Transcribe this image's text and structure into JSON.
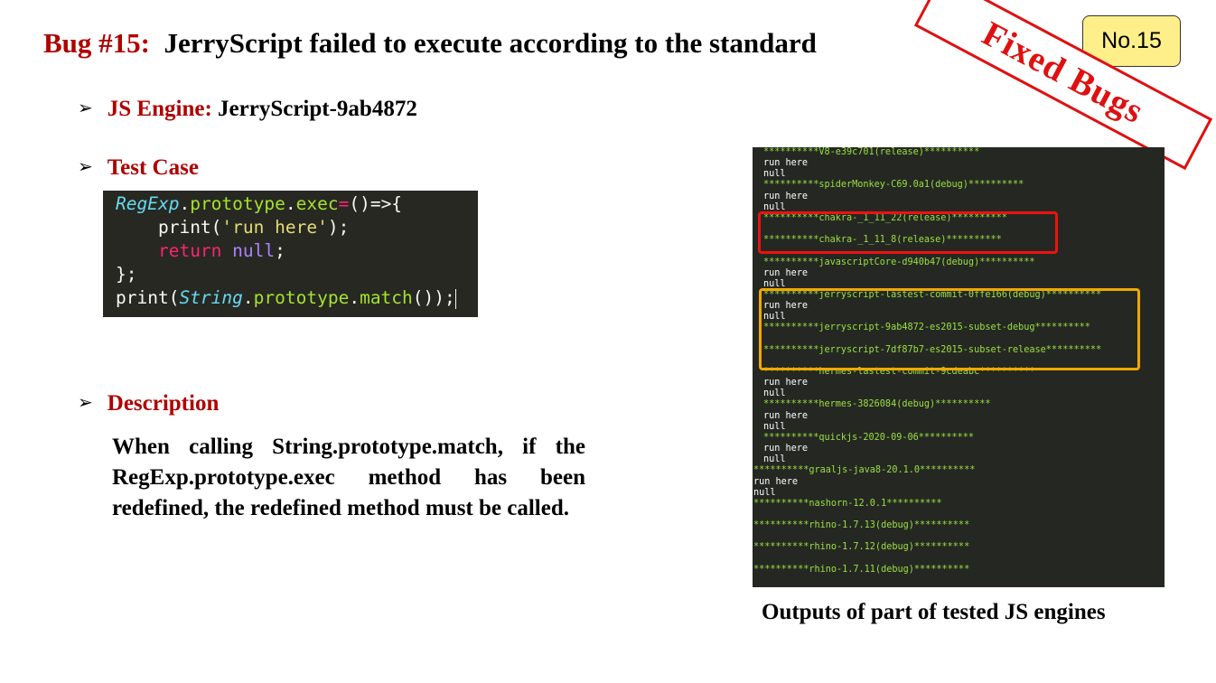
{
  "title": {
    "bug_number": "Bug #15:",
    "text": "JerryScript failed to execute according to the standard"
  },
  "badge": "No.15",
  "stamp": "Fixed Bugs",
  "engine": {
    "label": "JS Engine:",
    "value": "JerryScript-9ab4872"
  },
  "test_case": {
    "label": "Test Case"
  },
  "code": {
    "l1_cls": "RegExp",
    "l1_dot1": ".",
    "l1_proto": "prototype",
    "l1_dot2": ".",
    "l1_exec": "exec",
    "l1_eq": "=",
    "l1_arrow": "()=>{",
    "l2_indent": "    ",
    "l2_fn": "print(",
    "l2_str": "'run here'",
    "l2_end": ");",
    "l3_indent": "    ",
    "l3_kw": "return",
    "l3_sp": " ",
    "l3_lit": "null",
    "l3_end": ";",
    "l4": "};",
    "l5_fn": "print(",
    "l5_cls": "String",
    "l5_dot1": ".",
    "l5_proto": "prototype",
    "l5_dot2": ".",
    "l5_match": "match",
    "l5_end": "());"
  },
  "description": {
    "label": "Description",
    "text": "When calling String.prototype.match, if the RegExp.prototype.exec method has been redefined, the redefined method must be called."
  },
  "terminal": [
    {
      "text": "**********V8-e39c701(release)**********",
      "hdr": true,
      "indent": 1
    },
    {
      "text": "run here",
      "hdr": false,
      "indent": 1
    },
    {
      "text": "null",
      "hdr": false,
      "indent": 1
    },
    {
      "text": "**********spiderMonkey-C69.0a1(debug)**********",
      "hdr": true,
      "indent": 1
    },
    {
      "text": "run here",
      "hdr": false,
      "indent": 1
    },
    {
      "text": "null",
      "hdr": false,
      "indent": 1
    },
    {
      "text": "**********chakra-_1_11_22(release)**********",
      "hdr": true,
      "indent": 1
    },
    {
      "text": "",
      "hdr": false,
      "indent": 1
    },
    {
      "text": "**********chakra-_1_11_8(release)**********",
      "hdr": true,
      "indent": 1
    },
    {
      "text": "",
      "hdr": false,
      "indent": 1
    },
    {
      "text": "**********javascriptCore-d940b47(debug)**********",
      "hdr": true,
      "indent": 1
    },
    {
      "text": "run here",
      "hdr": false,
      "indent": 1
    },
    {
      "text": "null",
      "hdr": false,
      "indent": 1
    },
    {
      "text": "**********jerryscript-lastest-commit-0ffe166(debug)**********",
      "hdr": true,
      "indent": 1
    },
    {
      "text": "run here",
      "hdr": false,
      "indent": 1
    },
    {
      "text": "null",
      "hdr": false,
      "indent": 1
    },
    {
      "text": "**********jerryscript-9ab4872-es2015-subset-debug**********",
      "hdr": true,
      "indent": 1
    },
    {
      "text": "",
      "hdr": false,
      "indent": 1
    },
    {
      "text": "**********jerryscript-7df87b7-es2015-subset-release**********",
      "hdr": true,
      "indent": 1
    },
    {
      "text": "",
      "hdr": false,
      "indent": 1
    },
    {
      "text": "**********hermes-lastest-commit-9cdeabc**********",
      "hdr": true,
      "indent": 1
    },
    {
      "text": "run here",
      "hdr": false,
      "indent": 1
    },
    {
      "text": "null",
      "hdr": false,
      "indent": 1
    },
    {
      "text": "**********hermes-3826084(debug)**********",
      "hdr": true,
      "indent": 1
    },
    {
      "text": "run here",
      "hdr": false,
      "indent": 1
    },
    {
      "text": "null",
      "hdr": false,
      "indent": 1
    },
    {
      "text": "**********quickjs-2020-09-06**********",
      "hdr": true,
      "indent": 1
    },
    {
      "text": "run here",
      "hdr": false,
      "indent": 1
    },
    {
      "text": "null",
      "hdr": false,
      "indent": 1
    },
    {
      "text": "**********graaljs-java8-20.1.0**********",
      "hdr": true,
      "indent": 0
    },
    {
      "text": "run here",
      "hdr": false,
      "indent": 0
    },
    {
      "text": "null",
      "hdr": false,
      "indent": 0
    },
    {
      "text": "**********nashorn-12.0.1**********",
      "hdr": true,
      "indent": 0
    },
    {
      "text": "",
      "hdr": false,
      "indent": 0
    },
    {
      "text": "**********rhino-1.7.13(debug)**********",
      "hdr": true,
      "indent": 0
    },
    {
      "text": "",
      "hdr": false,
      "indent": 0
    },
    {
      "text": "**********rhino-1.7.12(debug)**********",
      "hdr": true,
      "indent": 0
    },
    {
      "text": "",
      "hdr": false,
      "indent": 0
    },
    {
      "text": "**********rhino-1.7.11(debug)**********",
      "hdr": true,
      "indent": 0
    }
  ],
  "caption": "Outputs of part of tested JS engines",
  "colors": {
    "title_red": "#b00000",
    "stamp_red": "#e01010",
    "badge_yellow": "#ffef8a",
    "terminal_bg": "#252822",
    "terminal_header": "#9bdf43",
    "red_box": "#ee1111",
    "yellow_box": "#f0a800"
  }
}
